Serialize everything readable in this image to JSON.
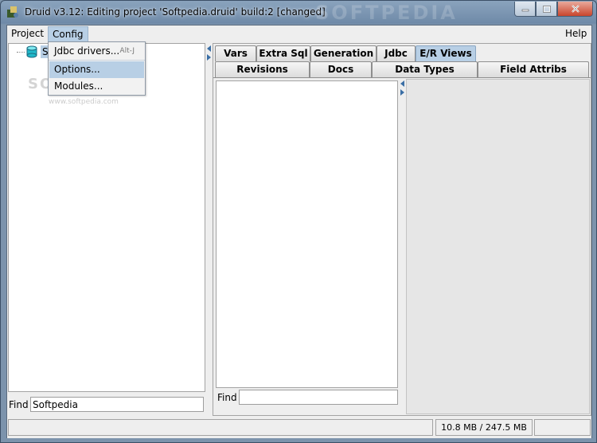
{
  "window": {
    "title": "Druid v3.12: Editing project 'Softpedia.druid' build:2 [changed]",
    "watermark": "SOFTPEDIA"
  },
  "menubar": {
    "project": "Project",
    "config": "Config",
    "help": "Help"
  },
  "config_menu": {
    "items": [
      {
        "label": "Jdbc drivers...",
        "shortcut": "Alt-J"
      },
      {
        "label": "Options...",
        "shortcut": ""
      },
      {
        "label": "Modules...",
        "shortcut": ""
      }
    ]
  },
  "tree": {
    "root_label": "S",
    "watermark": "SOFTPEDIA",
    "watermark_url": "www.softpedia.com"
  },
  "left_find": {
    "label": "Find",
    "value": "Softpedia"
  },
  "tabs": {
    "row1": [
      "Vars",
      "Extra Sql",
      "Generation",
      "Jdbc",
      "E/R Views"
    ],
    "row2": [
      "Revisions",
      "Docs",
      "Data Types",
      "Field Attribs"
    ],
    "selected": "E/R Views"
  },
  "right_find": {
    "label": "Find",
    "value": ""
  },
  "status": {
    "memory": "10.8 MB / 247.5 MB"
  },
  "colors": {
    "selection": "#b8cfe5",
    "titlebar": "#7c93ac"
  }
}
